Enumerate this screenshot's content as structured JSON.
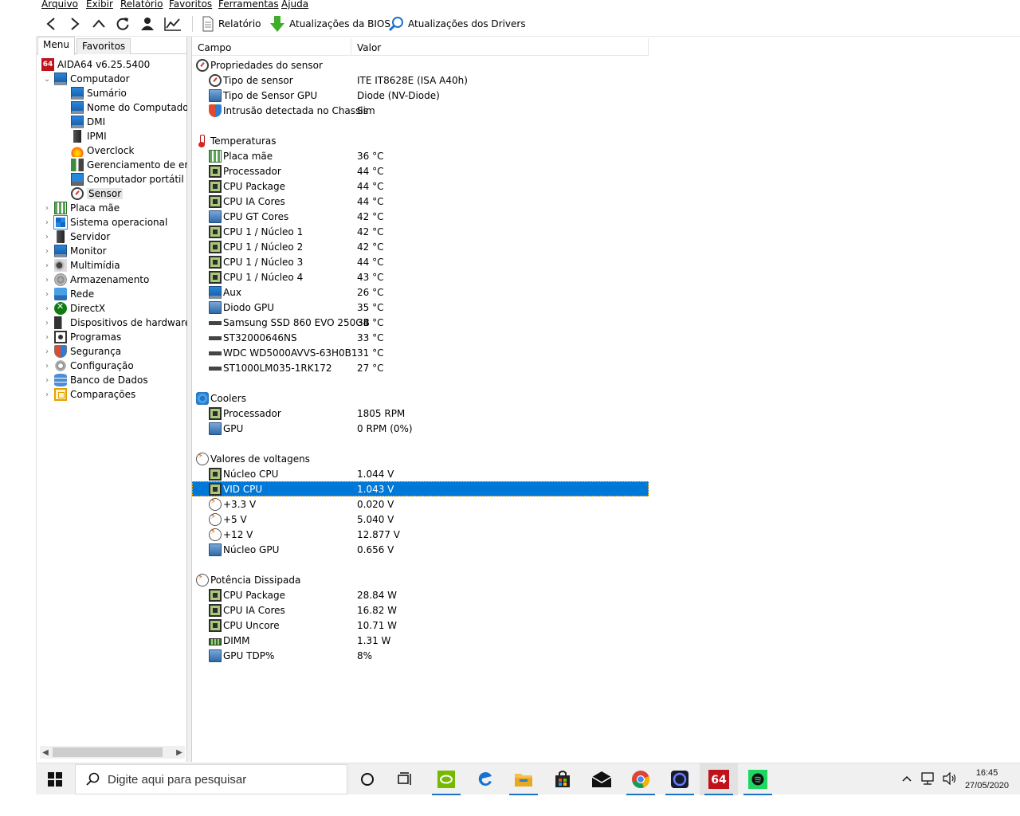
{
  "menu": [
    "Arquivo",
    "Exibir",
    "Relatório",
    "Favoritos",
    "Ferramentas",
    "Ajuda"
  ],
  "toolbar": {
    "report_label": "Relatório",
    "bios_label": "Atualizações da BIOS",
    "drivers_label": "Atualizações dos Drivers"
  },
  "left": {
    "tabs": [
      "Menu",
      "Favoritos"
    ],
    "root": "AIDA64 v6.25.5400",
    "computer": "Computador",
    "computer_children": [
      "Sumário",
      "Nome do Computador",
      "DMI",
      "IPMI",
      "Overclock",
      "Gerenciamento de ener",
      "Computador portátil",
      "Sensor"
    ],
    "categories": [
      "Placa mãe",
      "Sistema operacional",
      "Servidor",
      "Monitor",
      "Multimídia",
      "Armazenamento",
      "Rede",
      "DirectX",
      "Dispositivos de hardware",
      "Programas",
      "Segurança",
      "Configuração",
      "Banco de Dados",
      "Comparações"
    ]
  },
  "columns": {
    "field": "Campo",
    "value": "Valor"
  },
  "groups": [
    {
      "title": "Propriedades do sensor",
      "icon": "gauge-icon",
      "rows": [
        {
          "field": "Tipo de sensor",
          "value": "ITE IT8628E  (ISA A40h)",
          "icon": "gauge-icon"
        },
        {
          "field": "Tipo de Sensor GPU",
          "value": "Diode  (NV-Diode)",
          "icon": "gpu-icon"
        },
        {
          "field": "Intrusão detectada no Chassis",
          "value": "Sim",
          "icon": "shield-icon"
        }
      ]
    },
    {
      "title": "Temperaturas",
      "icon": "thermometer-icon",
      "rows": [
        {
          "field": "Placa mãe",
          "value": "36 °C",
          "icon": "motherboard-icon"
        },
        {
          "field": "Processador",
          "value": "44 °C",
          "icon": "chip-icon"
        },
        {
          "field": "CPU Package",
          "value": "44 °C",
          "icon": "chip-icon"
        },
        {
          "field": "CPU IA Cores",
          "value": "44 °C",
          "icon": "chip-icon"
        },
        {
          "field": "CPU GT Cores",
          "value": "42 °C",
          "icon": "gpu-icon"
        },
        {
          "field": "CPU 1 / Núcleo 1",
          "value": "42 °C",
          "icon": "chip-icon"
        },
        {
          "field": "CPU 1 / Núcleo 2",
          "value": "42 °C",
          "icon": "chip-icon"
        },
        {
          "field": "CPU 1 / Núcleo 3",
          "value": "44 °C",
          "icon": "chip-icon"
        },
        {
          "field": "CPU 1 / Núcleo 4",
          "value": "43 °C",
          "icon": "chip-icon"
        },
        {
          "field": "Aux",
          "value": "26 °C",
          "icon": "monitor-icon"
        },
        {
          "field": "Diodo GPU",
          "value": "35 °C",
          "icon": "gpu-icon"
        },
        {
          "field": "Samsung SSD 860 EVO 250GB",
          "value": "34 °C",
          "icon": "disk-icon"
        },
        {
          "field": "ST32000646NS",
          "value": "33 °C",
          "icon": "disk-icon"
        },
        {
          "field": "WDC WD5000AVVS-63H0B1",
          "value": "31 °C",
          "icon": "disk-icon"
        },
        {
          "field": "ST1000LM035-1RK172",
          "value": "27 °C",
          "icon": "disk-icon"
        }
      ]
    },
    {
      "title": "Coolers",
      "icon": "fan-icon",
      "rows": [
        {
          "field": "Processador",
          "value": "1805 RPM",
          "icon": "chip-icon"
        },
        {
          "field": "GPU",
          "value": "0 RPM  (0%)",
          "icon": "gpu-icon"
        }
      ]
    },
    {
      "title": "Valores de voltagens",
      "icon": "voltage-icon",
      "rows": [
        {
          "field": "Núcleo CPU",
          "value": "1.044 V",
          "icon": "chip-icon"
        },
        {
          "field": "VID CPU",
          "value": "1.043 V",
          "icon": "chip-icon",
          "selected": true
        },
        {
          "field": "+3.3 V",
          "value": "0.020 V",
          "icon": "voltage-icon"
        },
        {
          "field": "+5 V",
          "value": "5.040 V",
          "icon": "voltage-icon"
        },
        {
          "field": "+12 V",
          "value": "12.877 V",
          "icon": "voltage-icon"
        },
        {
          "field": "Núcleo GPU",
          "value": "0.656 V",
          "icon": "gpu-icon"
        }
      ]
    },
    {
      "title": "Potência Dissipada",
      "icon": "voltage-icon",
      "rows": [
        {
          "field": "CPU Package",
          "value": "28.84 W",
          "icon": "chip-icon"
        },
        {
          "field": "CPU IA Cores",
          "value": "16.82 W",
          "icon": "chip-icon"
        },
        {
          "field": "CPU Uncore",
          "value": "10.71 W",
          "icon": "chip-icon"
        },
        {
          "field": "DIMM",
          "value": "1.31 W",
          "icon": "dimm-icon"
        },
        {
          "field": "GPU TDP%",
          "value": "8%",
          "icon": "gpu-icon"
        }
      ]
    }
  ],
  "taskbar": {
    "search_placeholder": "Digite aqui para pesquisar",
    "time": "16:45",
    "date": "27/05/2020",
    "app_aida_label": "64"
  },
  "colors": {
    "selection": "#0078d7",
    "accent": "#1a73c9"
  }
}
